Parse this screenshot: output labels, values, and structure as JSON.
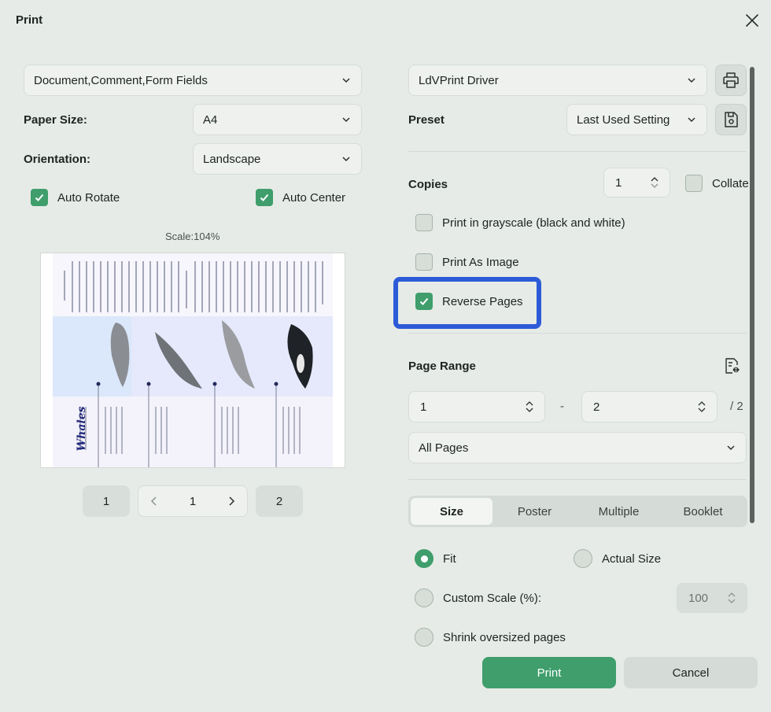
{
  "window": {
    "title": "Print"
  },
  "left": {
    "content_select": "Document,Comment,Form Fields",
    "paper_size_label": "Paper Size:",
    "paper_size_value": "A4",
    "orientation_label": "Orientation:",
    "orientation_value": "Landscape",
    "auto_rotate": {
      "label": "Auto Rotate",
      "checked": true
    },
    "auto_center": {
      "label": "Auto Center",
      "checked": true
    },
    "scale_text": "Scale:104%",
    "preview": {
      "heading": "Whales"
    },
    "pagination": {
      "first": "1",
      "current": "1",
      "last": "2"
    }
  },
  "right": {
    "printer": "LdVPrint Driver",
    "preset_label": "Preset",
    "preset_value": "Last Used Setting",
    "copies_label": "Copies",
    "copies_value": "1",
    "collate": {
      "label": "Collate",
      "checked": false
    },
    "grayscale": {
      "label": "Print in grayscale (black and white)",
      "checked": false
    },
    "as_image": {
      "label": "Print As Image",
      "checked": false
    },
    "reverse": {
      "label": "Reverse Pages",
      "checked": true
    },
    "page_range_label": "Page Range",
    "range_from": "1",
    "range_dash": "-",
    "range_to": "2",
    "range_total": "/ 2",
    "pages_select": "All Pages",
    "tabs": [
      {
        "label": "Size",
        "active": true
      },
      {
        "label": "Poster",
        "active": false
      },
      {
        "label": "Multiple",
        "active": false
      },
      {
        "label": "Booklet",
        "active": false
      }
    ],
    "fit": {
      "label": "Fit",
      "selected": true
    },
    "actual_size": {
      "label": "Actual Size",
      "selected": false
    },
    "custom_scale": {
      "label": "Custom Scale (%):",
      "selected": false,
      "value": "100"
    },
    "shrink": {
      "label": "Shrink oversized pages",
      "selected": false
    }
  },
  "footer": {
    "print": "Print",
    "cancel": "Cancel"
  },
  "colors": {
    "accent": "#3f9e6c",
    "highlight": "#2d5bd8",
    "background": "#e6ebe7"
  },
  "icons": {
    "printer": "printer-icon",
    "save": "save-preset-icon",
    "page_range": "page-range-icon",
    "close": "close-icon"
  }
}
